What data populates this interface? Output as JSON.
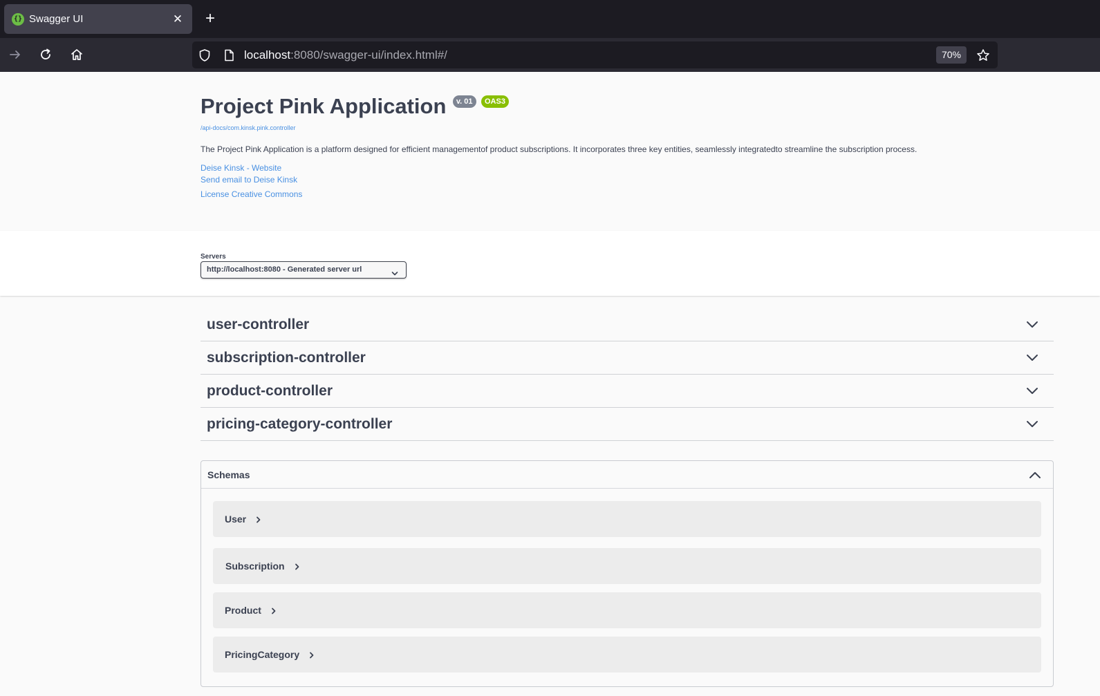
{
  "browser": {
    "tab_title": "Swagger UI",
    "favicon_glyph": "{}",
    "close_glyph": "✕",
    "new_tab_glyph": "+",
    "url_host": "localhost",
    "url_rest": ":8080/swagger-ui/index.html#/",
    "zoom": "70%",
    "icons": [
      "forward-icon",
      "reload-icon",
      "home-icon",
      "shield-icon",
      "page-icon",
      "star-icon"
    ]
  },
  "info": {
    "title": "Project Pink Application",
    "version_badge": "v. 01",
    "oas_badge": "OAS3",
    "api_docs_link": "/api-docs/com.kinsk.pink.controller",
    "description": "The Project Pink Application is a platform designed for efficient managementof product subscriptions. It incorporates three key entities, seamlessly integratedto streamline the subscription process.",
    "website_link": "Deise Kinsk - Website",
    "email_link": "Send email to Deise Kinsk",
    "license_link": "License Creative Commons"
  },
  "servers": {
    "label": "Servers",
    "selected": "http://localhost:8080 - Generated server url"
  },
  "controllers": [
    {
      "name": "user-controller"
    },
    {
      "name": "subscription-controller"
    },
    {
      "name": "product-controller"
    },
    {
      "name": "pricing-category-controller"
    }
  ],
  "schemas": {
    "title": "Schemas",
    "items": [
      {
        "name": "User"
      },
      {
        "name": "Subscription"
      },
      {
        "name": "Product"
      },
      {
        "name": "PricingCategory"
      }
    ]
  },
  "colors": {
    "link": "#4990e2",
    "text": "#3b4151",
    "oas_badge": "#89bf04",
    "version_badge": "#7d8492",
    "browser_dark": "#1c1b22"
  }
}
